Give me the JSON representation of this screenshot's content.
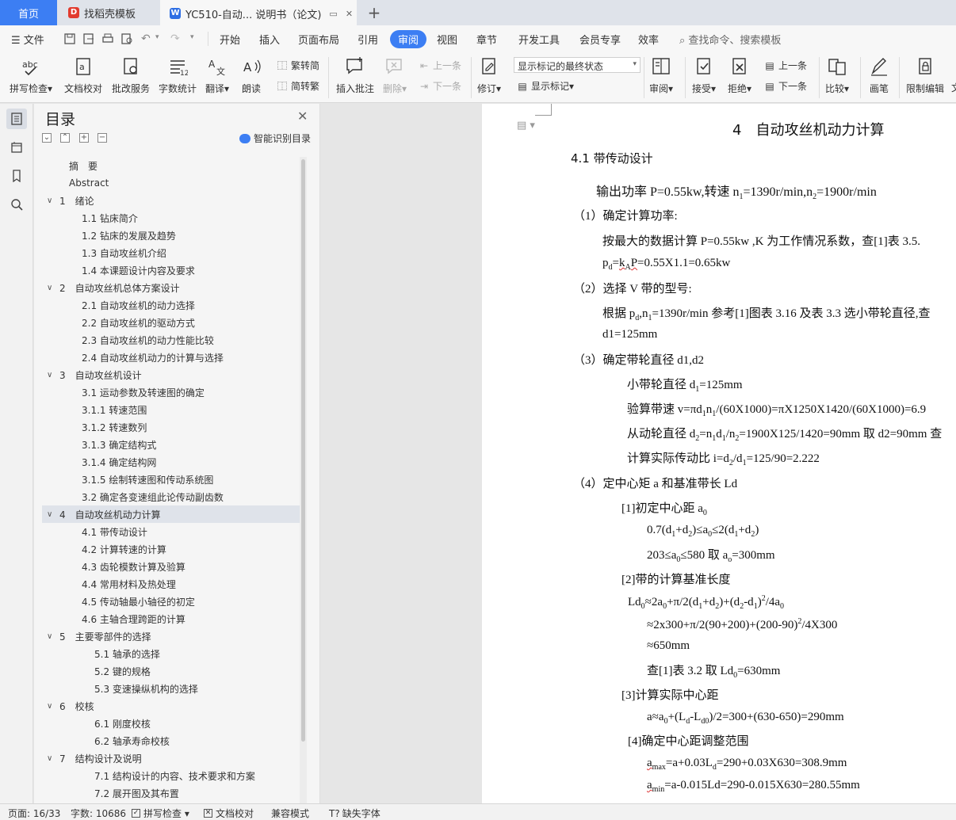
{
  "tabs": {
    "home": "首页",
    "template": "找稻壳模板",
    "document": "YC510-自动... 说明书（论文)",
    "add": "+"
  },
  "menu": {
    "file": "文件",
    "items": [
      "开始",
      "插入",
      "页面布局",
      "引用",
      "审阅",
      "视图",
      "章节",
      "开发工具",
      "会员专享",
      "效率"
    ],
    "active": "审阅",
    "search": "查找命令、搜索模板"
  },
  "ribbon": {
    "spell": "拼写检查",
    "doc_check": "文档校对",
    "batch": "批改服务",
    "wordcount": "字数统计",
    "translate": "翻译",
    "read": "朗读",
    "trad": "繁转简",
    "simp": "简转繁",
    "insert_comment": "插入批注",
    "delete": "删除",
    "prev_comment": "上一条",
    "next_comment": "下一条",
    "revise": "修订",
    "markup_state": "显示标记的最终状态",
    "show_markup": "显示标记",
    "review": "审阅",
    "accept": "接受",
    "reject": "拒绝",
    "prev_change": "上一条",
    "next_change": "下一条",
    "compare": "比较",
    "pen": "画笔",
    "restrict": "限制编辑",
    "more": "文"
  },
  "toc": {
    "title": "目录",
    "smart": "智能识别目录",
    "items": [
      {
        "text": "摘　要",
        "level": 0,
        "arrow": false
      },
      {
        "text": "Abstract",
        "level": 0,
        "arrow": false
      },
      {
        "text": "1　绪论",
        "level": 0,
        "arrow": true
      },
      {
        "text": "1.1  钻床简介",
        "level": 1,
        "arrow": false
      },
      {
        "text": "1.2  钻床的发展及趋势",
        "level": 1,
        "arrow": false
      },
      {
        "text": "1.3  自动攻丝机介绍",
        "level": 1,
        "arrow": false
      },
      {
        "text": "1.4  本课题设计内容及要求",
        "level": 1,
        "arrow": false
      },
      {
        "text": "2　自动攻丝机总体方案设计",
        "level": 0,
        "arrow": true
      },
      {
        "text": "2.1  自动攻丝机的动力选择",
        "level": 1,
        "arrow": false
      },
      {
        "text": "2.2  自动攻丝机的驱动方式",
        "level": 1,
        "arrow": false
      },
      {
        "text": "2.3  自动攻丝机的动力性能比较",
        "level": 1,
        "arrow": false
      },
      {
        "text": "2.4  自动攻丝机动力的计算与选择",
        "level": 1,
        "arrow": false
      },
      {
        "text": "3　自动攻丝机设计",
        "level": 0,
        "arrow": true
      },
      {
        "text": "3.1  运动参数及转速图的确定",
        "level": 1,
        "arrow": false
      },
      {
        "text": "3.1.1 转速范围",
        "level": 1,
        "arrow": false
      },
      {
        "text": "3.1.2 转速数列",
        "level": 1,
        "arrow": false
      },
      {
        "text": "3.1.3 确定结构式",
        "level": 1,
        "arrow": false
      },
      {
        "text": "3.1.4 确定结构网",
        "level": 1,
        "arrow": false
      },
      {
        "text": "3.1.5 绘制转速图和传动系统图",
        "level": 1,
        "arrow": false
      },
      {
        "text": "3.2  确定各变速组此论传动副齿数",
        "level": 1,
        "arrow": false
      },
      {
        "text": "4　自动攻丝机动力计算",
        "level": 0,
        "arrow": true,
        "selected": true
      },
      {
        "text": "4.1  带传动设计",
        "level": 1,
        "arrow": false
      },
      {
        "text": "4.2  计算转速的计算",
        "level": 1,
        "arrow": false
      },
      {
        "text": "4.3  齿轮模数计算及验算",
        "level": 1,
        "arrow": false
      },
      {
        "text": "4.4  常用材料及热处理",
        "level": 1,
        "arrow": false
      },
      {
        "text": "4.5  传动轴最小轴径的初定",
        "level": 1,
        "arrow": false
      },
      {
        "text": "4.6  主轴合理跨距的计算",
        "level": 1,
        "arrow": false
      },
      {
        "text": "5　主要零部件的选择",
        "level": 0,
        "arrow": true
      },
      {
        "text": "5.1  轴承的选择",
        "level": 2,
        "arrow": false
      },
      {
        "text": "5.2  键的规格",
        "level": 2,
        "arrow": false
      },
      {
        "text": "5.3  变速操纵机构的选择",
        "level": 2,
        "arrow": false
      },
      {
        "text": "6　校核",
        "level": 0,
        "arrow": true
      },
      {
        "text": "6.1  刚度校核",
        "level": 2,
        "arrow": false
      },
      {
        "text": "6.2  轴承寿命校核",
        "level": 2,
        "arrow": false
      },
      {
        "text": "7　结构设计及说明",
        "level": 0,
        "arrow": true
      },
      {
        "text": "7.1  结构设计的内容、技术要求和方案",
        "level": 2,
        "arrow": false
      },
      {
        "text": "7.2  展开图及其布置",
        "level": 2,
        "arrow": false
      }
    ]
  },
  "doc": {
    "chapter": "4　自动攻丝机动力计算",
    "section": "4.1  带传动设计",
    "lines": {
      "l1": "输出功率 P=0.55kw,转速 n",
      "l2": "（1）确定计算功率:",
      "l3": "按最大的数据计算 P=0.55kw ,K 为工作情况系数，查[1]表 3.5.",
      "l5": "（2）选择 V 带的型号:",
      "l6": "根据 p",
      "l7": "d1=125mm",
      "l8": "（3）确定带轮直径 d1,d2",
      "l13": "（4）定中心矩 a 和基准带长 Ld",
      "l14": "[1]初定中心距 a",
      "l17": "[2]带的计算基准长度",
      "l19": "≈2x300+π/2(90+200)+(200-90)",
      "l20": "≈650mm",
      "l22": "[3]计算实际中心距",
      "l24": "[4]确定中心距调整范围"
    }
  },
  "status": {
    "page": "页面: 16/33",
    "words": "字数: 10686",
    "spell": "拼写检查",
    "check": "文档校对",
    "compat": "兼容模式",
    "font": "缺失字体"
  }
}
